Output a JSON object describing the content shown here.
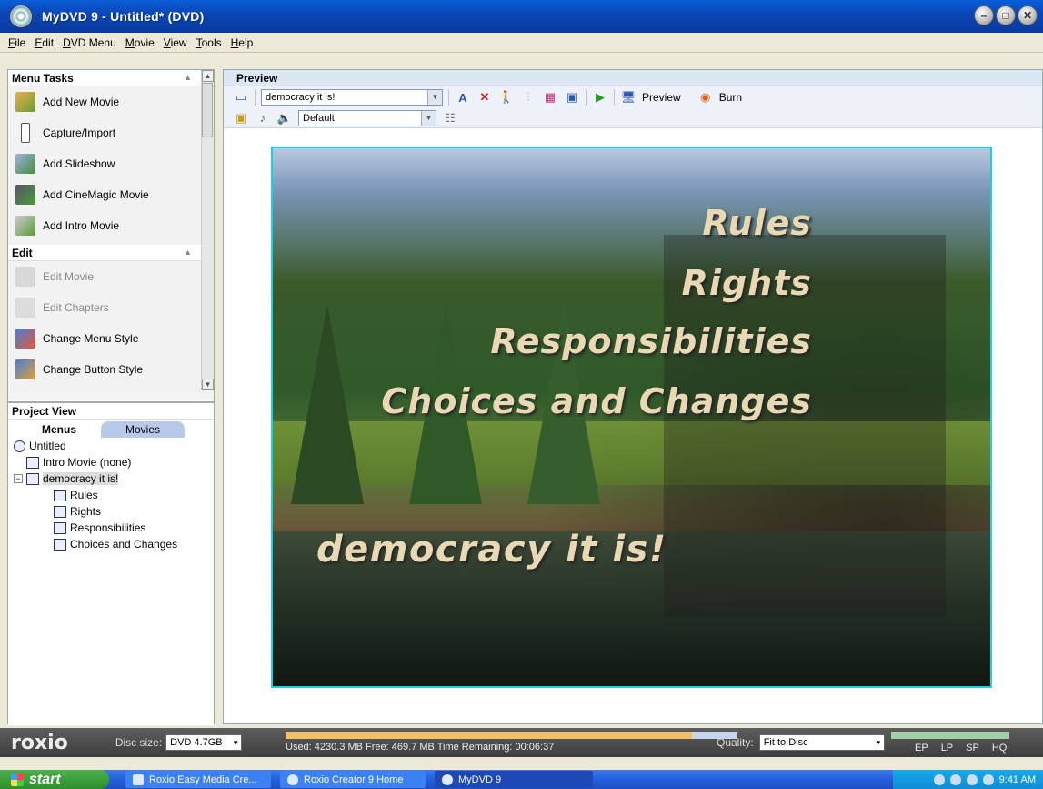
{
  "window": {
    "title": "MyDVD 9 - Untitled* (DVD)"
  },
  "menubar": [
    "File",
    "Edit",
    "DVD Menu",
    "Movie",
    "View",
    "Tools",
    "Help"
  ],
  "menu_tasks": {
    "title": "Menu Tasks",
    "items": [
      {
        "label": "Add New Movie",
        "icon": "add-movie-icon"
      },
      {
        "label": "Capture/Import",
        "icon": "capture-icon"
      },
      {
        "label": "Add Slideshow",
        "icon": "slideshow-icon"
      },
      {
        "label": "Add CineMagic Movie",
        "icon": "cinemagic-icon"
      },
      {
        "label": "Add Intro Movie",
        "icon": "intro-movie-icon"
      }
    ]
  },
  "edit_tasks": {
    "title": "Edit",
    "items": [
      {
        "label": "Edit Movie",
        "icon": "edit-movie-icon",
        "disabled": true
      },
      {
        "label": "Edit Chapters",
        "icon": "edit-chapters-icon",
        "disabled": true
      },
      {
        "label": "Change Menu Style",
        "icon": "menu-style-icon",
        "disabled": false
      },
      {
        "label": "Change Button Style",
        "icon": "button-style-icon",
        "disabled": false
      }
    ]
  },
  "project_view": {
    "title": "Project View",
    "tabs": [
      "Menus",
      "Movies"
    ],
    "tree": [
      {
        "label": "Untitled",
        "level": 0
      },
      {
        "label": "Intro Movie (none)",
        "level": 1
      },
      {
        "label": "democracy it is!",
        "level": 1,
        "selected": true
      },
      {
        "label": "Rules",
        "level": 2
      },
      {
        "label": "Rights",
        "level": 2
      },
      {
        "label": "Responsibilities",
        "level": 2
      },
      {
        "label": "Choices and Changes",
        "level": 2
      }
    ]
  },
  "preview": {
    "header": "Preview",
    "menu_select": "democracy it is!",
    "style_select": "Default",
    "preview_label": "Preview",
    "burn_label": "Burn",
    "menu_items": [
      "Rules",
      "Rights",
      "Responsibilities",
      "Choices and Changes"
    ],
    "menu_title": "democracy it is!"
  },
  "status": {
    "brand": "roxio",
    "disc_size_label": "Disc size:",
    "disc_size": "DVD 4.7GB",
    "usage_text": "Used: 4230.3 MB  Free: 469.7 MB  Time Remaining: 00:06:37",
    "used_fraction": 0.9,
    "quality_label": "Quality:",
    "quality_value": "Fit to Disc",
    "quality_scale": [
      "EP",
      "LP",
      "SP",
      "HQ"
    ]
  },
  "taskbar": {
    "start": "start",
    "items": [
      {
        "label": "Roxio Easy Media Cre...",
        "active": false
      },
      {
        "label": "Roxio Creator 9 Home",
        "active": false
      },
      {
        "label": "MyDVD 9",
        "active": true
      }
    ],
    "clock": "9:41 AM"
  },
  "colors": {
    "titlebar": "#0b47b8",
    "menu_text": "#e9d8b4",
    "stage_border": "#1fd0d8"
  }
}
